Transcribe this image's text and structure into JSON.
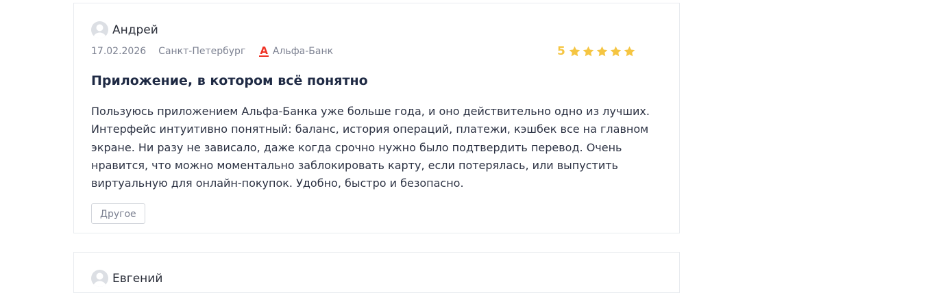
{
  "reviews": [
    {
      "author": "Андрей",
      "date": "17.02.2026",
      "city": "Санкт-Петербург",
      "bank": "Альфа-Банк",
      "bank_logo_letter": "А",
      "rating": "5",
      "stars": 5,
      "title": "Приложение, в котором всё понятно",
      "text": "Пользуюсь приложением Альфа-Банка уже больше года, и оно действительно одно из лучших. Интерфейс интуитивно понятный: баланс, история операций, платежи, кэшбек все на главном экране. Ни разу не зависало, даже когда срочно нужно было подтвердить перевод. Очень нравится, что можно моментально заблокировать карту, если потерялась, или выпустить виртуальную для онлайн-покупок. Удобно, быстро и безопасно.",
      "tag": "Другое"
    },
    {
      "author": "Евгений"
    }
  ],
  "colors": {
    "star": "#f5c542",
    "bank_brand": "#ef3124",
    "border": "#e8ebef"
  },
  "icons": {
    "avatar": "user-avatar-icon",
    "star": "star-icon",
    "bank_logo": "alfa-bank-logo-icon"
  }
}
